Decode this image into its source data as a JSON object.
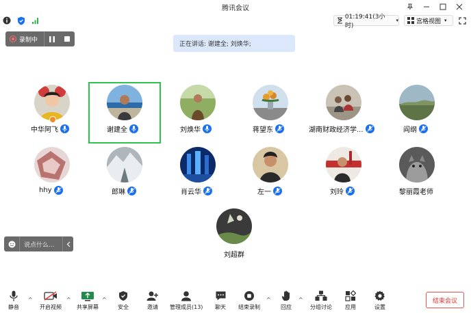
{
  "window": {
    "title": "腾讯会议"
  },
  "infobar": {
    "timer": "01:19:41(3小时)",
    "view_mode": "宫格视图"
  },
  "recording": {
    "label": "录制中"
  },
  "speaking": {
    "text": "正在讲话: 谢建全; 刘焕华;"
  },
  "participants": [
    {
      "name": "中华阿飞",
      "mic": "active",
      "host": true
    },
    {
      "name": "谢建全",
      "mic": "active",
      "host": false,
      "active": true
    },
    {
      "name": "刘焕华",
      "mic": "active",
      "host": false
    },
    {
      "name": "蒋望东",
      "mic": "muted",
      "host": false
    },
    {
      "name": "湖南财政经济学...",
      "mic": "muted",
      "host": false
    },
    {
      "name": "阎纲",
      "mic": "muted",
      "host": false
    },
    {
      "name": "hhy",
      "mic": "muted",
      "host": false
    },
    {
      "name": "郎琳",
      "mic": "muted",
      "host": false
    },
    {
      "name": "肖云华",
      "mic": "muted",
      "host": false
    },
    {
      "name": "左一",
      "mic": "muted",
      "host": false
    },
    {
      "name": "刘玲",
      "mic": "muted",
      "host": false
    },
    {
      "name": "黎丽霞老师",
      "mic": "none",
      "host": false
    },
    {
      "name": "刘超群",
      "mic": "none",
      "host": false
    }
  ],
  "chat": {
    "placeholder": "说点什么..."
  },
  "toolbar": {
    "mute": "静音",
    "video": "开启视频",
    "share": "共享屏幕",
    "security": "安全",
    "invite": "邀请",
    "members": "管理成员(13)",
    "chat": "聊天",
    "end_record": "结束录制",
    "react": "回应",
    "breakout": "分组讨论",
    "apps": "应用",
    "settings": "设置",
    "end_meeting": "结束会议"
  },
  "colors": {
    "accent": "#1a6ff0",
    "active_border": "#2cc44a",
    "end": "#e33333"
  }
}
